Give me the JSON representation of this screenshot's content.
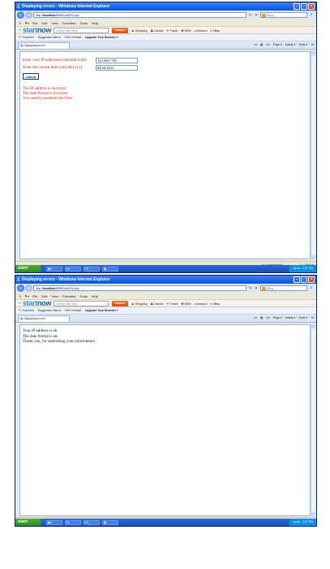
{
  "shots": [
    {
      "window_title": "Displaying errors - Windows Internet Explorer",
      "url_prefix": "http://",
      "url_host": "localhost",
      "url_rest": ":8080/Lab2/Vo.php",
      "search_placeholder": "Bing",
      "menu": [
        "File",
        "Edit",
        "View",
        "Favorites",
        "Tools",
        "Help"
      ],
      "startnow": {
        "brand_a": "start",
        "brand_b": "now",
        "search_placeholder": "Search with Bing",
        "search_button": "Search",
        "items": [
          "Shopping",
          "Games",
          "Travel",
          "MSN",
          "Amazon",
          "eBay"
        ]
      },
      "favorites": {
        "label": "Favorites",
        "items": [
          "Suggested Sites ▾",
          "Free Hotmail",
          "Upgrade Your Browser ▾"
        ]
      },
      "tab_title": "Displaying errors",
      "commands": [
        "Page ▾",
        "Safety ▾",
        "Tools ▾"
      ],
      "form": {
        "ip_label": "Enter your IP addresses (ddd.ddd.d.dd):",
        "ip_value": "123.456.7.89",
        "date_label": "Enter the current date (mm/dd/yyyy):",
        "date_value": "04/24/2012",
        "submit": "submit"
      },
      "errors": [
        "The IP address is incorrect",
        "The date format is incorrect",
        "You need to resubmit the form"
      ],
      "status_left": "",
      "status_zone": "Local intranet",
      "status_zoom": "100%",
      "taskbar": {
        "start": "start",
        "clock": "2:27 PM"
      }
    },
    {
      "window_title": "Displaying errors - Windows Internet Explorer",
      "url_prefix": "http://",
      "url_host": "localhost",
      "url_rest": ":8080/Lab2/Vo.php",
      "search_placeholder": "Bing",
      "menu": [
        "File",
        "Edit",
        "View",
        "Favorites",
        "Tools",
        "Help"
      ],
      "startnow": {
        "brand_a": "start",
        "brand_b": "now",
        "search_placeholder": "Search with Bing",
        "search_button": "Search",
        "items": [
          "Shopping",
          "Games",
          "Travel",
          "MSN",
          "Amazon",
          "eBay"
        ]
      },
      "favorites": {
        "label": "Favorites",
        "items": [
          "Suggested Sites ▾",
          "Free Hotmail",
          "Upgrade Your Browser ▾"
        ]
      },
      "tab_title": "Displaying errors",
      "commands": [
        "Page ▾",
        "Safety ▾",
        "Tools ▾"
      ],
      "messages": [
        "Your IP address is ok.",
        "The date format is ok.",
        "Thank you, for submitting your information!"
      ],
      "status_left": "Done",
      "status_zone": "Local intranet",
      "status_zoom": "100%",
      "taskbar": {
        "start": "start",
        "clock": "2:27 PM"
      }
    }
  ]
}
